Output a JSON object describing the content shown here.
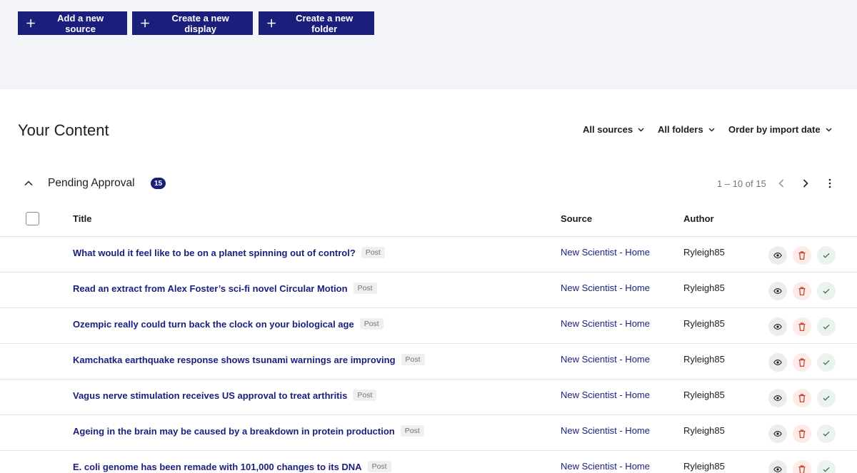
{
  "toolbar": {
    "add_source": "Add a new source",
    "create_display": "Create a new display",
    "create_folder": "Create a new folder"
  },
  "content": {
    "title": "Your Content",
    "filters": {
      "sources": "All sources",
      "folders": "All folders",
      "order": "Order by import date"
    }
  },
  "section": {
    "title": "Pending Approval",
    "count": "15",
    "pagination": "1 – 10 of 15"
  },
  "table": {
    "columns": {
      "title": "Title",
      "source": "Source",
      "author": "Author"
    },
    "rows": [
      {
        "title": "What would it feel like to be on a planet spinning out of control?",
        "type": "Post",
        "source": "New Scientist - Home",
        "author": "Ryleigh85"
      },
      {
        "title": "Read an extract from Alex Foster’s sci-fi novel Circular Motion",
        "type": "Post",
        "source": "New Scientist - Home",
        "author": "Ryleigh85"
      },
      {
        "title": "Ozempic really could turn back the clock on your biological age",
        "type": "Post",
        "source": "New Scientist - Home",
        "author": "Ryleigh85"
      },
      {
        "title": "Kamchatka earthquake response shows tsunami warnings are improving",
        "type": "Post",
        "source": "New Scientist - Home",
        "author": "Ryleigh85"
      },
      {
        "title": "Vagus nerve stimulation receives US approval to treat arthritis",
        "type": "Post",
        "source": "New Scientist - Home",
        "author": "Ryleigh85"
      },
      {
        "title": "Ageing in the brain may be caused by a breakdown in protein production",
        "type": "Post",
        "source": "New Scientist - Home",
        "author": "Ryleigh85"
      },
      {
        "title": "E. coli genome has been remade with 101,000 changes to its DNA",
        "type": "Post",
        "source": "New Scientist - Home",
        "author": "Ryleigh85"
      }
    ]
  },
  "icons": {
    "plus": "plus-icon",
    "chevron_down": "chevron-down-icon",
    "chevron_up": "chevron-up-icon",
    "chevron_left": "chevron-left-icon",
    "chevron_right": "chevron-right-icon",
    "more": "more-vertical-icon",
    "view": "eye-icon",
    "delete": "trash-icon",
    "approve": "check-icon"
  },
  "colors": {
    "primary": "#1b1f7c",
    "topbar_bg": "#f3f4f8",
    "delete": "#c73a2a",
    "approve": "#2a6a45"
  }
}
